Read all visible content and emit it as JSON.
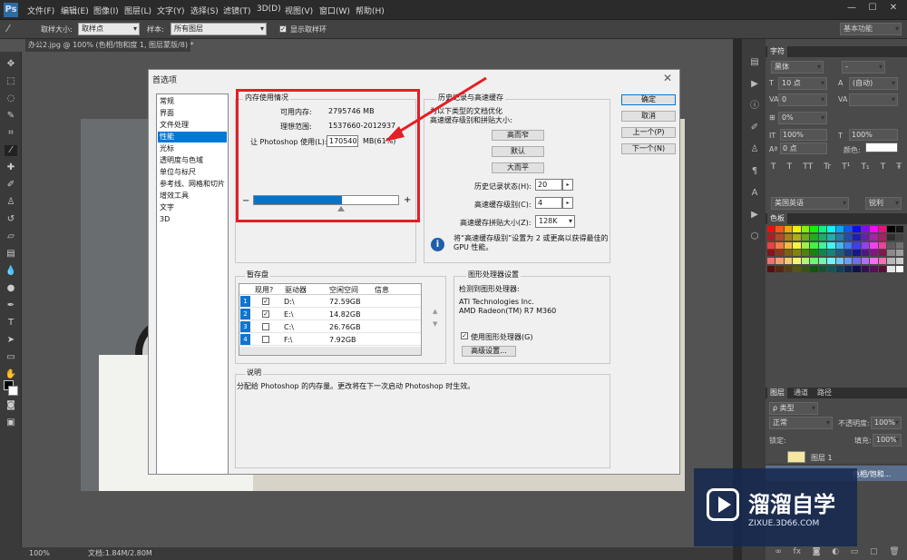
{
  "menubar": {
    "logo": "Ps",
    "items": [
      "文件(F)",
      "编辑(E)",
      "图像(I)",
      "图层(L)",
      "文字(Y)",
      "选择(S)",
      "滤镜(T)",
      "3D(D)",
      "视图(V)",
      "窗口(W)",
      "帮助(H)"
    ],
    "minimize": "—",
    "maximize": "☐",
    "close": "✕"
  },
  "options": {
    "sample_size_label": "取样大小:",
    "sample_size_value": "取样点",
    "sample_label": "样本:",
    "sample_value": "所有图层",
    "show_ring_label": "显示取样环",
    "workspace": "基本功能"
  },
  "document": {
    "tab": "办公2.jpg @ 100% (色相/饱和度 1, 图层蒙版/8) *",
    "zoom": "100%",
    "doc_info": "文档:1.84M/2.80M"
  },
  "dialog": {
    "title": "首选项",
    "close": "✕",
    "nav": [
      "常规",
      "界面",
      "文件处理",
      "性能",
      "光标",
      "透明度与色域",
      "单位与标尺",
      "参考线、网格和切片",
      "增效工具",
      "文字",
      "3D"
    ],
    "nav_active_index": 3,
    "memory": {
      "group": "内存使用情况",
      "available_label": "可用内存:",
      "available_value": "2795746 MB",
      "ideal_label": "理想范围:",
      "ideal_value": "1537660-2012937",
      "let_label": "让 Photoshop 使用(L):",
      "let_value": "1705405",
      "unit": "MB(61%)",
      "minus": "−",
      "plus": "+",
      "slider_percent": 61
    },
    "history": {
      "group": "历史记录与高速缓存",
      "desc1": "为以下类型的文档优化",
      "desc2": "高速缓存级别和拼贴大小:",
      "btn_tall": "高而窄",
      "btn_default": "默认",
      "btn_wide": "大而平",
      "states_label": "历史记录状态(H):",
      "states_value": "20",
      "levels_label": "高速缓存级别(C):",
      "levels_value": "4",
      "tile_label": "高速缓存拼贴大小(Z):",
      "tile_value": "128K",
      "info_text1": "将“高速缓存级别”设置为 2 或更高以获得最佳的",
      "info_text2": "GPU 性能。",
      "arrow": "▸"
    },
    "buttons": {
      "ok": "确定",
      "cancel": "取消",
      "prev": "上一个(P)",
      "next": "下一个(N)"
    },
    "scratch": {
      "group": "暂存盘",
      "headers": [
        "现用?",
        "驱动器",
        "空闲空间",
        "信息"
      ],
      "rows": [
        {
          "num": "1",
          "active": true,
          "drive": "D:\\",
          "free": "72.59GB"
        },
        {
          "num": "2",
          "active": true,
          "drive": "E:\\",
          "free": "14.82GB"
        },
        {
          "num": "3",
          "active": false,
          "drive": "C:\\",
          "free": "26.76GB"
        },
        {
          "num": "4",
          "active": false,
          "drive": "F:\\",
          "free": "7.92GB"
        }
      ],
      "up": "▲",
      "down": "▼"
    },
    "gpu": {
      "group": "图形处理器设置",
      "detected_label": "检测到图形处理器:",
      "vendor": "ATI Technologies Inc.",
      "model": "AMD Radeon(TM) R7 M360",
      "use_gpu_label": "使用图形处理器(G)",
      "advanced": "高级设置..."
    },
    "description": {
      "group": "说明",
      "text": "分配给 Photoshop 的内存量。更改将在下一次启动 Photoshop 时生效。"
    }
  },
  "char_panel": {
    "tab": "字符",
    "font": "黑体",
    "style": "-",
    "size": "10 点",
    "leading": "(自动)",
    "kerning": "0",
    "scale": "0%",
    "h_scale": "100%",
    "v_scale": "100%",
    "baseline": "0 点",
    "color_label": "颜色:",
    "language": "美国英语",
    "aa": "锐利",
    "typestyles": [
      "T",
      "T",
      "TT",
      "Tr",
      "T¹",
      "T₁",
      "T",
      "Ŧ"
    ]
  },
  "swatches": {
    "tab": "色板"
  },
  "layers": {
    "tabs": [
      "图层",
      "通道",
      "路径"
    ],
    "kind": "ρ 类型",
    "blend": "正常",
    "opacity_label": "不透明度:",
    "opacity_value": "100%",
    "lock_label": "锁定:",
    "fill_label": "填充:",
    "fill_value": "100%",
    "layer1": "图层 1",
    "layer2": "色相/饱和..."
  },
  "watermark": {
    "brand": "溜溜自学",
    "url": "ZIXUE.3D66.COM"
  }
}
